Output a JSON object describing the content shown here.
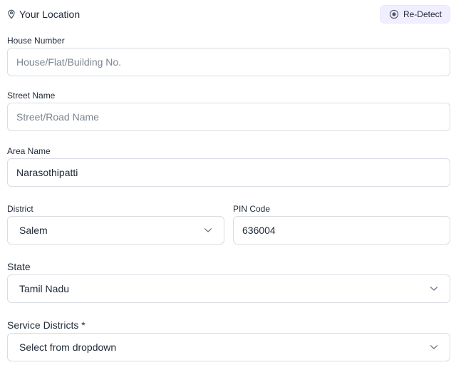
{
  "header": {
    "title": "Your Location",
    "redetect_label": "Re-Detect"
  },
  "form": {
    "house_number": {
      "label": "House Number",
      "placeholder": "House/Flat/Building No.",
      "value": ""
    },
    "street_name": {
      "label": "Street Name",
      "placeholder": "Street/Road Name",
      "value": ""
    },
    "area_name": {
      "label": "Area Name",
      "placeholder": "",
      "value": "Narasothipatti"
    },
    "district": {
      "label": "District",
      "selected": "Salem"
    },
    "pin_code": {
      "label": "PIN Code",
      "value": "636004"
    },
    "state": {
      "label": "State",
      "selected": "Tamil Nadu"
    },
    "service_districts": {
      "label": "Service Districts *",
      "selected": "Select from dropdown"
    }
  },
  "colors": {
    "accent_bg": "#f1efff",
    "border": "#d9dde3",
    "placeholder": "#7c8591",
    "text": "#1f2937"
  },
  "icons": {
    "location": "map-pin-icon",
    "redetect": "target-icon",
    "dropdown": "chevron-down-icon"
  }
}
